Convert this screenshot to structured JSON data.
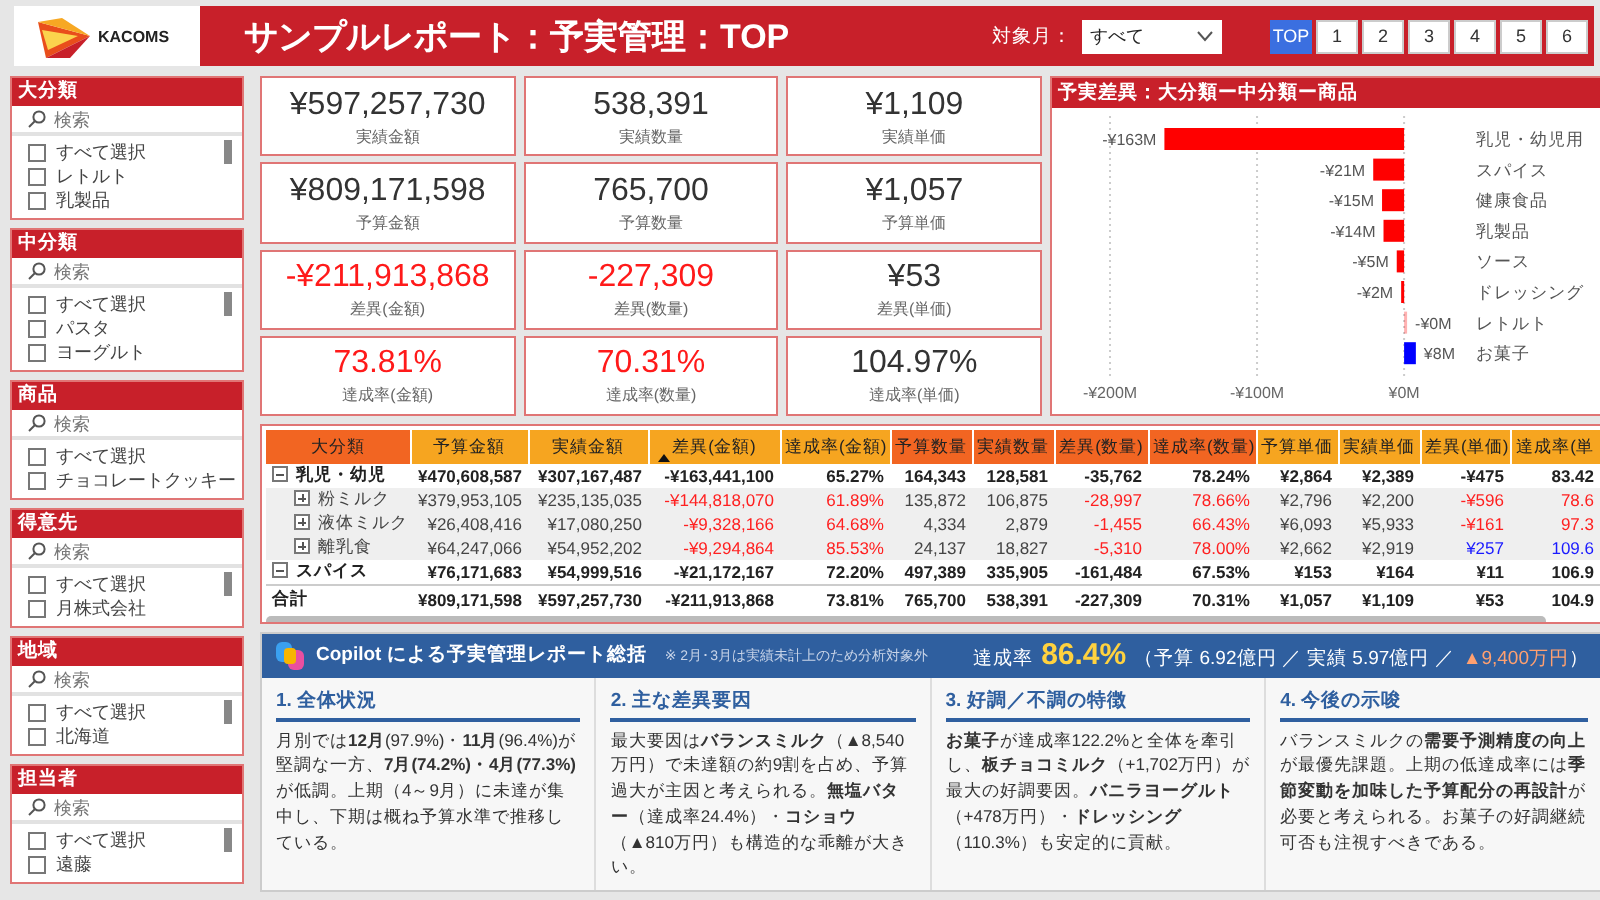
{
  "header": {
    "logo": "KACOMS",
    "title": "サンプルレポート：予実管理：TOP",
    "filter_label": "対象月：",
    "filter_value": "すべて",
    "pages": [
      {
        "label": "TOP",
        "selected": true
      },
      {
        "label": "1",
        "selected": false
      },
      {
        "label": "2",
        "selected": false
      },
      {
        "label": "3",
        "selected": false
      },
      {
        "label": "4",
        "selected": false
      },
      {
        "label": "5",
        "selected": false
      },
      {
        "label": "6",
        "selected": false
      }
    ]
  },
  "slicers": [
    {
      "title": "大分類",
      "placeholder": "検索",
      "items": [
        {
          "label": "すべて選択",
          "checked": false
        },
        {
          "label": "レトルト",
          "checked": false
        },
        {
          "label": "乳製品",
          "checked": false
        }
      ]
    },
    {
      "title": "中分類",
      "placeholder": "検索",
      "items": [
        {
          "label": "すべて選択",
          "checked": false
        },
        {
          "label": "パスタ",
          "checked": false
        },
        {
          "label": "ヨーグルト",
          "checked": false
        }
      ]
    },
    {
      "title": "商品",
      "placeholder": "検索",
      "items": [
        {
          "label": "すべて選択",
          "checked": false
        },
        {
          "label": "チョコレートクッキー",
          "checked": false
        }
      ]
    },
    {
      "title": "得意先",
      "placeholder": "検索",
      "items": [
        {
          "label": "すべて選択",
          "checked": false
        },
        {
          "label": "月株式会社",
          "checked": false
        }
      ]
    },
    {
      "title": "地域",
      "placeholder": "検索",
      "items": [
        {
          "label": "すべて選択",
          "checked": false
        },
        {
          "label": "北海道",
          "checked": false
        }
      ]
    },
    {
      "title": "担当者",
      "placeholder": "検索",
      "items": [
        {
          "label": "すべて選択",
          "checked": false
        },
        {
          "label": "遠藤",
          "checked": false
        }
      ]
    }
  ],
  "kpis": [
    {
      "value": "¥597,257,730",
      "label": "実績金額",
      "color": "#333333"
    },
    {
      "value": "538,391",
      "label": "実績数量",
      "color": "#333333"
    },
    {
      "value": "¥1,109",
      "label": "実績単価",
      "color": "#333333"
    },
    {
      "value": "¥809,171,598",
      "label": "予算金額",
      "color": "#333333"
    },
    {
      "value": "765,700",
      "label": "予算数量",
      "color": "#333333"
    },
    {
      "value": "¥1,057",
      "label": "予算単価",
      "color": "#333333"
    },
    {
      "value": "-¥211,913,868",
      "label": "差異(金額)",
      "color": "#ff1a1a"
    },
    {
      "value": "-227,309",
      "label": "差異(数量)",
      "color": "#ff1a1a"
    },
    {
      "value": "¥53",
      "label": "差異(単価)",
      "color": "#333333"
    },
    {
      "value": "73.81%",
      "label": "達成率(金額)",
      "color": "#ff1a1a"
    },
    {
      "value": "70.31%",
      "label": "達成率(数量)",
      "color": "#ff1a1a"
    },
    {
      "value": "104.97%",
      "label": "達成率(単価)",
      "color": "#333333"
    }
  ],
  "variance_chart": {
    "title": "予実差異：大分類ー中分類ー商品",
    "chart_data": {
      "type": "bar",
      "orientation": "horizontal",
      "categories": [
        "乳児・幼児用",
        "スパイス",
        "健康食品",
        "乳製品",
        "ソース",
        "ドレッシング",
        "レトルト",
        "お菓子"
      ],
      "series": [
        {
          "color": "#ff0000",
          "values": [
            -163,
            -21,
            -15,
            -14,
            -5,
            -2,
            0,
            null
          ]
        },
        {
          "color": "#0000ff",
          "values": [
            null,
            null,
            null,
            null,
            null,
            null,
            null,
            8
          ]
        }
      ],
      "value_labels": [
        "-¥163M",
        "-¥21M",
        "-¥15M",
        "-¥14M",
        "-¥5M",
        "-¥2M",
        "-¥0M",
        "¥8M"
      ],
      "xlim": [
        -200,
        10
      ],
      "xticks": [
        {
          "value": -200,
          "label": "-¥200M"
        },
        {
          "value": -100,
          "label": "-¥100M"
        },
        {
          "value": 0,
          "label": "¥0M"
        }
      ]
    }
  },
  "table": {
    "columns": [
      {
        "label": "大分類",
        "color": "#f26522",
        "sorted": false
      },
      {
        "label": "予算金額",
        "color": "#f6a520",
        "sorted": false
      },
      {
        "label": "実績金額",
        "color": "#f6a520",
        "sorted": false
      },
      {
        "label": "差異(金額)",
        "color": "#f6a520",
        "sorted": true
      },
      {
        "label": "達成率(金額)",
        "color": "#f6a520",
        "sorted": false
      },
      {
        "label": "予算数量",
        "color": "#f26522",
        "sorted": false
      },
      {
        "label": "実績数量",
        "color": "#f26522",
        "sorted": false
      },
      {
        "label": "差異(数量)",
        "color": "#f26522",
        "sorted": false
      },
      {
        "label": "達成率(数量)",
        "color": "#f26522",
        "sorted": false
      },
      {
        "label": "予算単価",
        "color": "#f6a520",
        "sorted": false
      },
      {
        "label": "実績単価",
        "color": "#f6a520",
        "sorted": false
      },
      {
        "label": "差異(単価)",
        "color": "#f6a520",
        "sorted": false
      },
      {
        "label": "達成率(単",
        "color": "#f6a520",
        "sorted": false
      }
    ],
    "rows": [
      {
        "kind": "group",
        "expanded": true,
        "cells": [
          "乳児・幼児",
          "¥470,608,587",
          "¥307,167,487",
          "-¥163,441,100",
          "65.27%",
          "164,343",
          "128,581",
          "-35,762",
          "78.24%",
          "¥2,864",
          "¥2,389",
          "-¥475",
          "83.42"
        ],
        "children": [
          {
            "expanded": false,
            "cells": [
              "粉ミルク",
              "¥379,953,105",
              "¥235,135,035",
              {
                "text": "-¥144,818,070",
                "color": "#ff2020"
              },
              {
                "text": "61.89%",
                "color": "#ff2020"
              },
              "135,872",
              "106,875",
              {
                "text": "-28,997",
                "color": "#ff2020"
              },
              {
                "text": "78.66%",
                "color": "#ff2020"
              },
              "¥2,796",
              "¥2,200",
              {
                "text": "-¥596",
                "color": "#ff2020"
              },
              {
                "text": "78.6",
                "color": "#ff2020"
              }
            ]
          },
          {
            "expanded": false,
            "cells": [
              "液体ミルク",
              "¥26,408,416",
              "¥17,080,250",
              {
                "text": "-¥9,328,166",
                "color": "#ff2020"
              },
              {
                "text": "64.68%",
                "color": "#ff2020"
              },
              "4,334",
              "2,879",
              {
                "text": "-1,455",
                "color": "#ff2020"
              },
              {
                "text": "66.43%",
                "color": "#ff2020"
              },
              "¥6,093",
              "¥5,933",
              {
                "text": "-¥161",
                "color": "#ff2020"
              },
              {
                "text": "97.3",
                "color": "#ff2020"
              }
            ]
          },
          {
            "expanded": false,
            "cells": [
              "離乳食",
              "¥64,247,066",
              "¥54,952,202",
              {
                "text": "-¥9,294,864",
                "color": "#ff2020"
              },
              {
                "text": "85.53%",
                "color": "#ff2020"
              },
              "24,137",
              "18,827",
              {
                "text": "-5,310",
                "color": "#ff2020"
              },
              {
                "text": "78.00%",
                "color": "#ff2020"
              },
              "¥2,662",
              "¥2,919",
              {
                "text": "¥257",
                "color": "#1a1aff"
              },
              {
                "text": "109.6",
                "color": "#1a1aff"
              }
            ]
          }
        ]
      },
      {
        "kind": "group",
        "expanded": true,
        "cells": [
          "スパイス",
          "¥76,171,683",
          "¥54,999,516",
          "-¥21,172,167",
          "72.20%",
          "497,389",
          "335,905",
          "-161,484",
          "67.53%",
          "¥153",
          "¥164",
          "¥11",
          "106.9"
        ]
      },
      {
        "kind": "total",
        "cells": [
          "合計",
          "¥809,171,598",
          "¥597,257,730",
          "-¥211,913,868",
          "73.81%",
          "765,700",
          "538,391",
          "-227,309",
          "70.31%",
          "¥1,057",
          "¥1,109",
          "¥53",
          "104.9"
        ]
      }
    ]
  },
  "copilot": {
    "title": "Copilot による予実管理レポート総括",
    "note": "※ 2月･3月は実績未計上のため分析対象外",
    "summary": {
      "label": "達成率",
      "value": "86.4%",
      "detail": "（予算 6.92億円 ／ 実績 5.97億円 ／",
      "gap": "▲9,400万円",
      "close": "）"
    },
    "sections": [
      {
        "heading": "1. 全体状況",
        "text": "月別では**12月**(97.9%)・**11月**(96.4%)が堅調な一方、**7月(74.2%)・4月(77.3%)**が低調。上期（4～9月）に未達が集中し、下期は概ね予算水準で推移している。"
      },
      {
        "heading": "2. 主な差異要因",
        "text": "最大要因は**バランスミルク**（▲8,540万円）で未達額の約9割を占め、予算過大が主因と考えられる。**無塩バター**（達成率24.4%）・**コショウ**（▲810万円）も構造的な乖離が大きい。"
      },
      {
        "heading": "3. 好調／不調の特徴",
        "text": "**お菓子**が達成率122.2%と全体を牽引し、**板チョコミルク**（+1,702万円）が最大の好調要因。**バニラヨーグルト**（+478万円）・**ドレッシング**（110.3%）も安定的に貢献。"
      },
      {
        "heading": "4. 今後の示唆",
        "text": "バランスミルクの**需要予測精度の向上**が最優先課題。上期の低達成率には**季節変動を加味した予算配分の再設計**が必要と考えられる。お菓子の好調継続可否も注視すべきである。"
      }
    ]
  }
}
